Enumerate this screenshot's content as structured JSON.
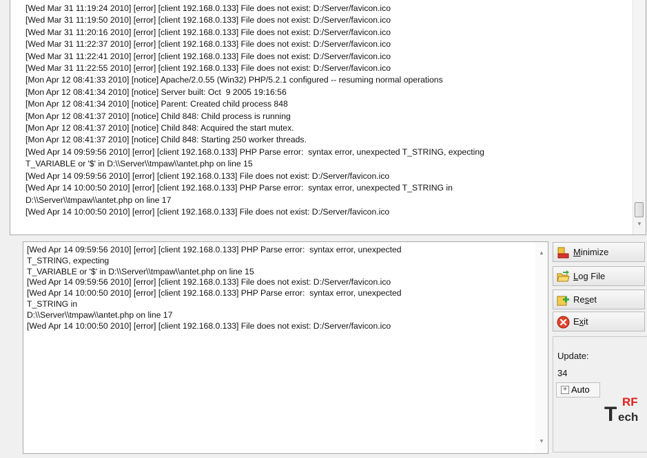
{
  "top_log": {
    "lines": [
      "[Wed Mar 31 11:19:24 2010] [error] [client 192.168.0.133] File does not exist: D:/Server/favicon.ico",
      "[Wed Mar 31 11:19:50 2010] [error] [client 192.168.0.133] File does not exist: D:/Server/favicon.ico",
      "[Wed Mar 31 11:20:16 2010] [error] [client 192.168.0.133] File does not exist: D:/Server/favicon.ico",
      "[Wed Mar 31 11:22:37 2010] [error] [client 192.168.0.133] File does not exist: D:/Server/favicon.ico",
      "[Wed Mar 31 11:22:41 2010] [error] [client 192.168.0.133] File does not exist: D:/Server/favicon.ico",
      "[Wed Mar 31 11:22:55 2010] [error] [client 192.168.0.133] File does not exist: D:/Server/favicon.ico",
      "[Mon Apr 12 08:41:33 2010] [notice] Apache/2.0.55 (Win32) PHP/5.2.1 configured -- resuming normal operations",
      "[Mon Apr 12 08:41:34 2010] [notice] Server built: Oct  9 2005 19:16:56",
      "[Mon Apr 12 08:41:34 2010] [notice] Parent: Created child process 848",
      "[Mon Apr 12 08:41:37 2010] [notice] Child 848: Child process is running",
      "[Mon Apr 12 08:41:37 2010] [notice] Child 848: Acquired the start mutex.",
      "[Mon Apr 12 08:41:37 2010] [notice] Child 848: Starting 250 worker threads.",
      "[Wed Apr 14 09:59:56 2010] [error] [client 192.168.0.133] PHP Parse error:  syntax error, unexpected T_STRING, expecting",
      "T_VARIABLE or '$' in D:\\\\Server\\\\tmpaw\\\\antet.php on line 15",
      "[Wed Apr 14 09:59:56 2010] [error] [client 192.168.0.133] File does not exist: D:/Server/favicon.ico",
      "[Wed Apr 14 10:00:50 2010] [error] [client 192.168.0.133] PHP Parse error:  syntax error, unexpected T_STRING in",
      "D:\\\\Server\\\\tmpaw\\\\antet.php on line 17",
      "[Wed Apr 14 10:00:50 2010] [error] [client 192.168.0.133] File does not exist: D:/Server/favicon.ico"
    ]
  },
  "bottom_log": {
    "lines": [
      "[Wed Apr 14 09:59:56 2010] [error] [client 192.168.0.133] PHP Parse error:  syntax error, unexpected",
      "T_STRING, expecting",
      "T_VARIABLE or '$' in D:\\\\Server\\\\tmpaw\\\\antet.php on line 15",
      "[Wed Apr 14 09:59:56 2010] [error] [client 192.168.0.133] File does not exist: D:/Server/favicon.ico",
      "[Wed Apr 14 10:00:50 2010] [error] [client 192.168.0.133] PHP Parse error:  syntax error, unexpected",
      "T_STRING in",
      "D:\\\\Server\\\\tmpaw\\\\antet.php on line 17",
      "[Wed Apr 14 10:00:50 2010] [error] [client 192.168.0.133] File does not exist: D:/Server/favicon.ico"
    ]
  },
  "buttons": {
    "minimize": {
      "label_pre": "",
      "label_key": "M",
      "label_post": "inimize",
      "icon": "minimize-icon"
    },
    "log_file": {
      "label_pre": "",
      "label_key": "L",
      "label_post": "og File",
      "icon": "folder-open-icon"
    },
    "reset": {
      "label_pre": "Re",
      "label_key": "s",
      "label_post": "et",
      "icon": "reset-icon"
    },
    "exit": {
      "label_pre": "E",
      "label_key": "x",
      "label_post": "it",
      "icon": "close-icon"
    }
  },
  "update": {
    "label": "Update:",
    "value": "34",
    "auto_label": "Auto",
    "auto_toggle": "+"
  },
  "logo": {
    "top": "RF",
    "letter": "T",
    "bottom": "ech",
    "icon": "trf-tech-logo"
  },
  "colors": {
    "logo_red": "#e0201c",
    "logo_dark": "#2a2a2a"
  }
}
